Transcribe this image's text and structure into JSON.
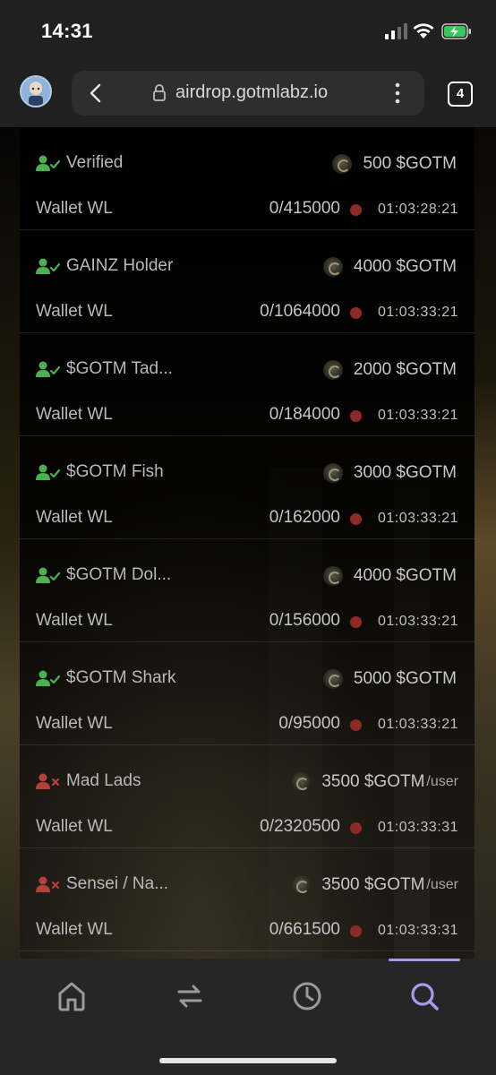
{
  "status_bar": {
    "time": "14:31"
  },
  "browser": {
    "url": "airdrop.gotmlabz.io",
    "tab_count": "4"
  },
  "rows": [
    {
      "role": "Verified",
      "eligible": true,
      "reward": "500 $GOTM",
      "suffix": "",
      "list": "Wallet WL",
      "claimed": "0/415000",
      "countdown": "01:03:28:21"
    },
    {
      "role": "GAINZ Holder",
      "eligible": true,
      "reward": "4000 $GOTM",
      "suffix": "",
      "list": "Wallet WL",
      "claimed": "0/1064000",
      "countdown": "01:03:33:21"
    },
    {
      "role": "$GOTM Tad...",
      "eligible": true,
      "reward": "2000 $GOTM",
      "suffix": "",
      "list": "Wallet WL",
      "claimed": "0/184000",
      "countdown": "01:03:33:21"
    },
    {
      "role": "$GOTM Fish",
      "eligible": true,
      "reward": "3000 $GOTM",
      "suffix": "",
      "list": "Wallet WL",
      "claimed": "0/162000",
      "countdown": "01:03:33:21"
    },
    {
      "role": "$GOTM Dol...",
      "eligible": true,
      "reward": "4000 $GOTM",
      "suffix": "",
      "list": "Wallet WL",
      "claimed": "0/156000",
      "countdown": "01:03:33:21"
    },
    {
      "role": "$GOTM Shark",
      "eligible": true,
      "reward": "5000 $GOTM",
      "suffix": "",
      "list": "Wallet WL",
      "claimed": "0/95000",
      "countdown": "01:03:33:21"
    },
    {
      "role": "Mad Lads",
      "eligible": false,
      "reward": "3500 $GOTM",
      "suffix": "/user",
      "list": "Wallet WL",
      "claimed": "0/2320500",
      "countdown": "01:03:33:31"
    },
    {
      "role": "Sensei / Na...",
      "eligible": false,
      "reward": "3500 $GOTM",
      "suffix": "/user",
      "list": "Wallet WL",
      "claimed": "0/661500",
      "countdown": "01:03:33:31"
    }
  ],
  "colors": {
    "eligible": "#4caf50",
    "ineligible": "#b5413a",
    "status_dot": "#8e2a26",
    "nav_active": "#a79af0",
    "nav_inactive": "#9a9a9a"
  },
  "bottom_nav": {
    "items": [
      {
        "icon": "home-icon",
        "active": false
      },
      {
        "icon": "swap-icon",
        "active": false
      },
      {
        "icon": "clock-icon",
        "active": false
      },
      {
        "icon": "search-icon",
        "active": true
      }
    ]
  }
}
